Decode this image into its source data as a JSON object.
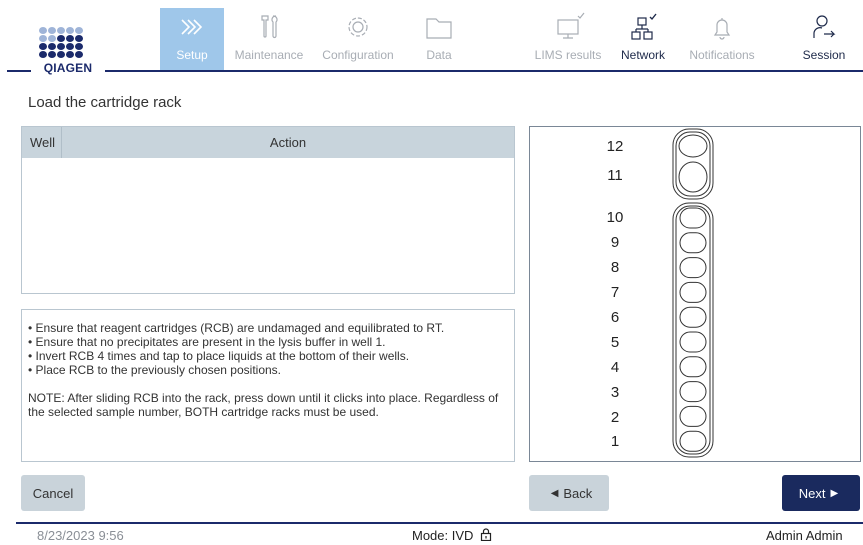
{
  "brand": {
    "logo_text": "QIAGEN",
    "dot_color": "#1b2a6b",
    "dot_light": "#9fb4d8"
  },
  "nav": {
    "setup": "Setup",
    "maintenance": "Maintenance",
    "configuration": "Configuration",
    "data": "Data",
    "lims": "LIMS results",
    "network": "Network",
    "notifications": "Notifications",
    "session": "Session"
  },
  "page_title": "Load the cartridge rack",
  "table": {
    "col_well": "Well",
    "col_action": "Action",
    "rows": []
  },
  "instructions": {
    "lines": [
      "• Ensure that reagent cartridges (RCB) are undamaged and equilibrated to RT.",
      "• Ensure that no precipitates are present in the lysis buffer in well 1.",
      "• Invert RCB 4 times and tap to place liquids at the bottom of their wells.",
      "• Place RCB to the previously chosen positions."
    ],
    "note": "NOTE: After sliding RCB into the rack, press down until it clicks into place. Regardless of the selected sample number, BOTH cartridge racks must be used."
  },
  "rack": {
    "top_group": [
      "12",
      "11"
    ],
    "bottom_group": [
      "10",
      "9",
      "8",
      "7",
      "6",
      "5",
      "4",
      "3",
      "2",
      "1"
    ]
  },
  "buttons": {
    "cancel": "Cancel",
    "back": "Back",
    "next": "Next"
  },
  "footer": {
    "datetime": "8/23/2023 9:56",
    "mode": "Mode: IVD",
    "user": "Admin Admin"
  },
  "colors": {
    "accent": "#9fc7ea",
    "primary": "#1a2a5e",
    "secondary_btn": "#c9d3da"
  }
}
